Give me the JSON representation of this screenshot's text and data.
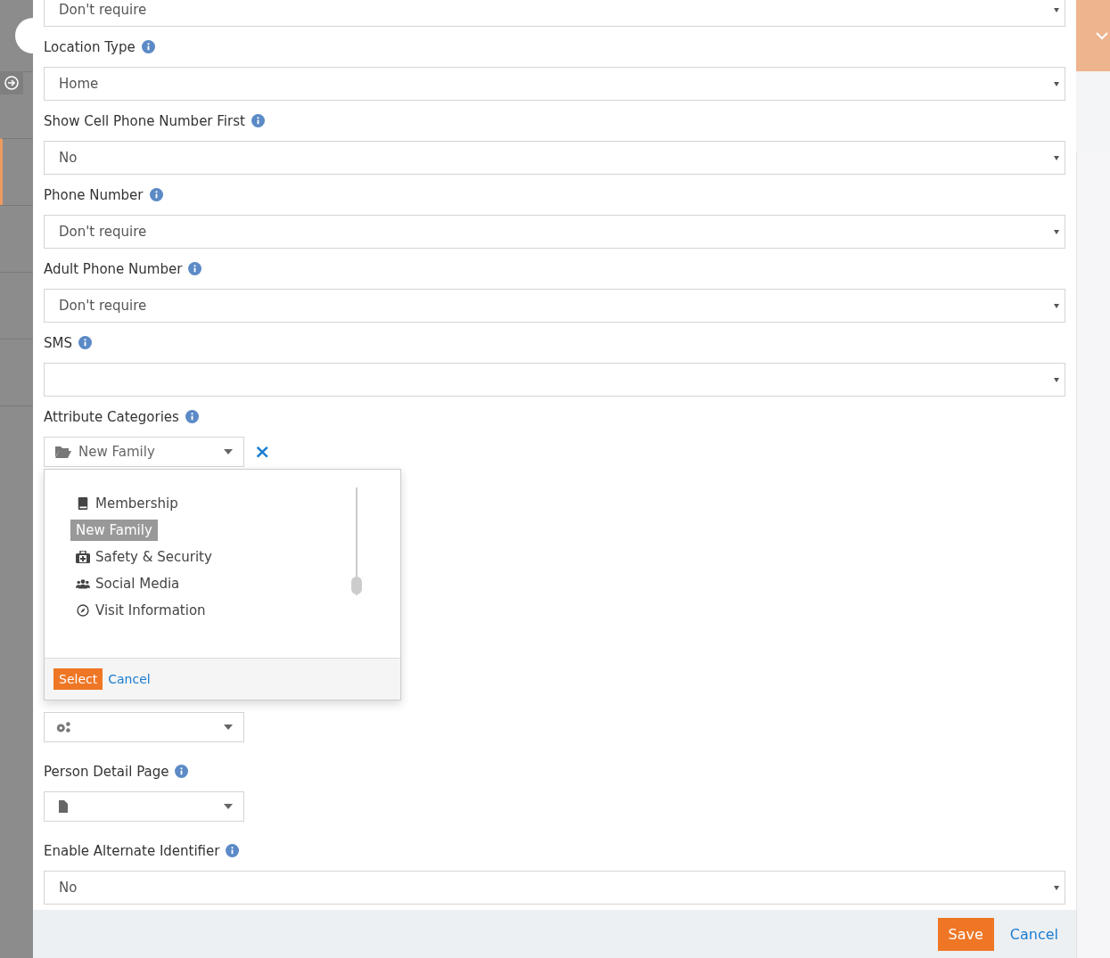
{
  "fields": [
    {
      "kind": "select",
      "value": "Don't require"
    },
    {
      "kind": "select",
      "label": "Location Type",
      "value": "Home"
    },
    {
      "kind": "select",
      "label": "Show Cell Phone Number First",
      "value": "No"
    },
    {
      "kind": "select",
      "label": "Phone Number",
      "value": "Don't require"
    },
    {
      "kind": "select",
      "label": "Adult Phone Number",
      "value": "Don't require"
    },
    {
      "kind": "select",
      "label": "SMS"
    },
    {
      "kind": "category-picker",
      "label": "Attribute Categories",
      "value": "New Family",
      "clear": "×"
    },
    {
      "kind": "workflow-picker"
    },
    {
      "kind": "page-picker",
      "label": "Person Detail Page"
    },
    {
      "kind": "select",
      "label": "Enable Alternate Identifier",
      "value": "No"
    }
  ],
  "category_dropdown": {
    "items": [
      {
        "label": "Membership",
        "selected": false
      },
      {
        "label": "New Family",
        "selected": true
      },
      {
        "label": "Safety & Security",
        "selected": false
      },
      {
        "label": "Social Media",
        "selected": false
      },
      {
        "label": "Visit Information",
        "selected": false
      }
    ],
    "buttons": [
      "Select",
      "Cancel"
    ]
  },
  "footer": {
    "buttons": [
      "Save",
      "Cancel"
    ]
  }
}
